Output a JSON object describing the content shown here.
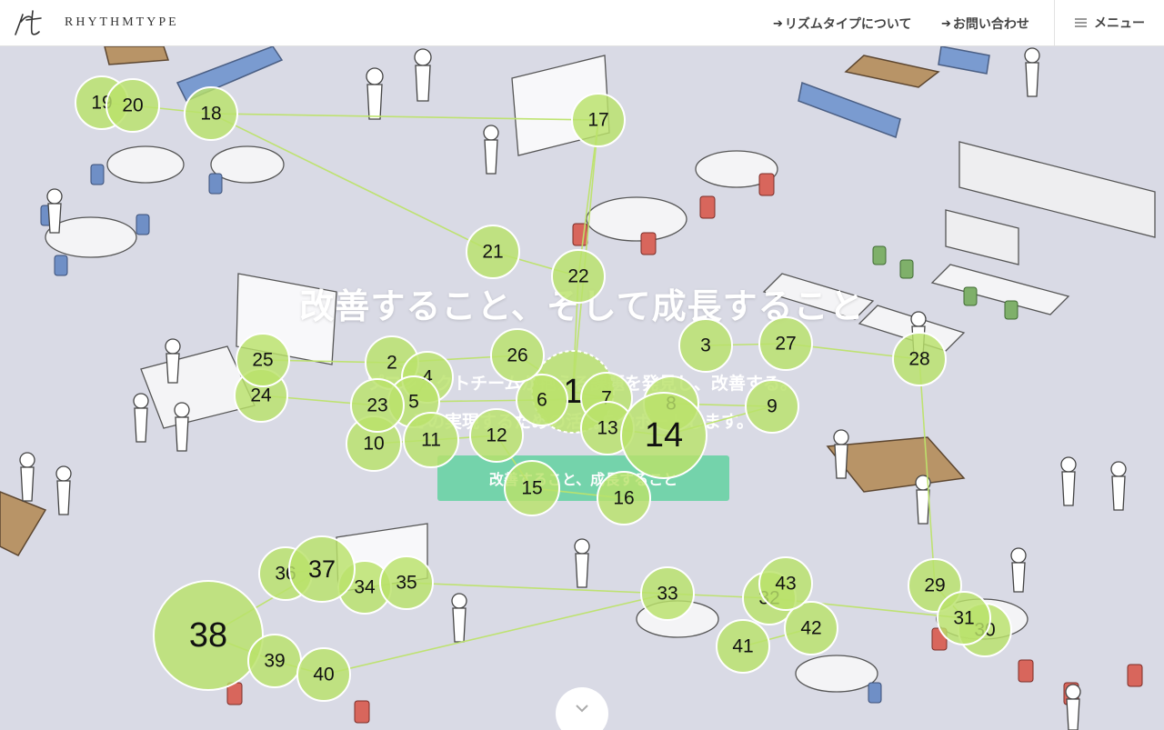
{
  "header": {
    "logo_text": "RHYTHMTYPE",
    "nav": [
      {
        "label": "リズムタイプについて",
        "icon": "arrow-right-icon"
      },
      {
        "label": "お問い合わせ",
        "icon": "arrow-right-icon"
      }
    ],
    "menu_label": "メニュー",
    "menu_icon": "hamburger-icon"
  },
  "hero": {
    "title": "改善すること、そして成長すること",
    "subtitle_line1": "プロジェクトチームが抱える課題を発見し、改善する。",
    "subtitle_line2": "その実現するための活動をサポートします。",
    "cta_label": "改善すること、成長すること",
    "scroll_icon": "chevron-down-icon"
  },
  "colors": {
    "bubble_fill": "#b9e26a",
    "bubble_stroke": "#ffffff",
    "link_line": "#b8e06a",
    "cta": "#6fd3a8",
    "header_bg": "#ffffff"
  },
  "bubbles": [
    {
      "id": "1",
      "label": "1"
    },
    {
      "id": "2",
      "label": "2"
    },
    {
      "id": "3",
      "label": "3"
    },
    {
      "id": "4",
      "label": "4"
    },
    {
      "id": "5",
      "label": "5"
    },
    {
      "id": "6",
      "label": "6"
    },
    {
      "id": "7",
      "label": "7"
    },
    {
      "id": "8",
      "label": "8"
    },
    {
      "id": "9",
      "label": "9"
    },
    {
      "id": "10",
      "label": "10"
    },
    {
      "id": "11",
      "label": "11"
    },
    {
      "id": "12",
      "label": "12"
    },
    {
      "id": "13",
      "label": "13"
    },
    {
      "id": "14",
      "label": "14"
    },
    {
      "id": "15",
      "label": "15"
    },
    {
      "id": "16",
      "label": "16"
    },
    {
      "id": "17",
      "label": "17"
    },
    {
      "id": "18",
      "label": "18"
    },
    {
      "id": "19",
      "label": "19"
    },
    {
      "id": "20",
      "label": "20"
    },
    {
      "id": "21",
      "label": "21"
    },
    {
      "id": "22",
      "label": "22"
    },
    {
      "id": "23",
      "label": "23"
    },
    {
      "id": "24",
      "label": "24"
    },
    {
      "id": "25",
      "label": "25"
    },
    {
      "id": "26",
      "label": "26"
    },
    {
      "id": "27",
      "label": "27"
    },
    {
      "id": "28",
      "label": "28"
    },
    {
      "id": "29",
      "label": "29"
    },
    {
      "id": "30",
      "label": "30"
    },
    {
      "id": "31",
      "label": "31"
    },
    {
      "id": "32",
      "label": "32"
    },
    {
      "id": "33",
      "label": "33"
    },
    {
      "id": "34",
      "label": "34"
    },
    {
      "id": "35",
      "label": "35"
    },
    {
      "id": "36",
      "label": "36"
    },
    {
      "id": "37",
      "label": "37"
    },
    {
      "id": "38",
      "label": "38"
    },
    {
      "id": "39",
      "label": "39"
    },
    {
      "id": "40",
      "label": "40"
    },
    {
      "id": "41",
      "label": "41"
    },
    {
      "id": "42",
      "label": "42"
    },
    {
      "id": "43",
      "label": "43"
    }
  ]
}
